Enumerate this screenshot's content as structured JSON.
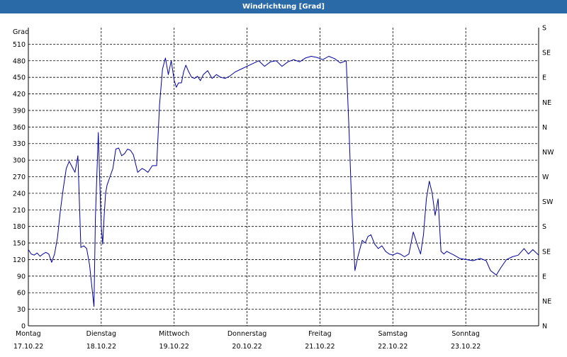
{
  "window": {
    "title": "Windrichtung [Grad]"
  },
  "chart_data": {
    "type": "line",
    "title": "Windrichtung [Grad]",
    "ylabel": "Grad",
    "ylim": [
      0,
      540
    ],
    "yticks": [
      0,
      30,
      60,
      90,
      120,
      150,
      180,
      210,
      240,
      270,
      300,
      330,
      360,
      390,
      420,
      450,
      480,
      510
    ],
    "right_axis": [
      "S",
      "SE",
      "E",
      "NE",
      "N",
      "NW",
      "W",
      "SW",
      "S",
      "SE",
      "E",
      "NE",
      "N"
    ],
    "xlim": [
      0,
      7
    ],
    "xticks": [
      {
        "day": "Montag",
        "date": "17.10.22"
      },
      {
        "day": "Dienstag",
        "date": "18.10.22"
      },
      {
        "day": "Mittwoch",
        "date": "19.10.22"
      },
      {
        "day": "Donnerstag",
        "date": "20.10.22"
      },
      {
        "day": "Freitag",
        "date": "21.10.22"
      },
      {
        "day": "Samstag",
        "date": "22.10.22"
      },
      {
        "day": "Sonntag",
        "date": "23.10.22"
      }
    ],
    "grid": true,
    "color": "#0000a0",
    "series": [
      {
        "name": "",
        "x": [
          0,
          0.04,
          0.08,
          0.12,
          0.16,
          0.2,
          0.24,
          0.28,
          0.32,
          0.36,
          0.4,
          0.44,
          0.48,
          0.52,
          0.56,
          0.6,
          0.64,
          0.68,
          0.72,
          0.76,
          0.8,
          0.84,
          0.88,
          0.9,
          0.92,
          0.96,
          0.98,
          1.0,
          1.02,
          1.04,
          1.06,
          1.08,
          1.12,
          1.16,
          1.2,
          1.24,
          1.28,
          1.32,
          1.36,
          1.4,
          1.44,
          1.5,
          1.56,
          1.6,
          1.64,
          1.7,
          1.76,
          1.8,
          1.84,
          1.88,
          1.92,
          1.96,
          2.0,
          2.03,
          2.06,
          2.1,
          2.13,
          2.16,
          2.2,
          2.24,
          2.28,
          2.32,
          2.36,
          2.4,
          2.46,
          2.52,
          2.58,
          2.64,
          2.7,
          2.76,
          2.84,
          2.92,
          3.0,
          3.08,
          3.16,
          3.24,
          3.32,
          3.4,
          3.48,
          3.56,
          3.64,
          3.72,
          3.8,
          3.88,
          3.96,
          4.04,
          4.12,
          4.2,
          4.28,
          4.36,
          4.4,
          4.44,
          4.48,
          4.52,
          4.55,
          4.58,
          4.62,
          4.66,
          4.7,
          4.75,
          4.8,
          4.85,
          4.9,
          4.95,
          5.0,
          5.06,
          5.1,
          5.16,
          5.22,
          5.28,
          5.34,
          5.38,
          5.42,
          5.46,
          5.5,
          5.54,
          5.58,
          5.62,
          5.66,
          5.7,
          5.74,
          5.78,
          5.84,
          5.92,
          6.0,
          6.1,
          6.2,
          6.28,
          6.34,
          6.38,
          6.42,
          6.48,
          6.56,
          6.64,
          6.72,
          6.8,
          6.86,
          6.92,
          7.0
        ],
        "y": [
          138,
          130,
          128,
          132,
          126,
          130,
          133,
          130,
          115,
          130,
          160,
          210,
          250,
          285,
          298,
          288,
          278,
          308,
          142,
          145,
          140,
          110,
          60,
          35,
          195,
          350,
          260,
          180,
          148,
          200,
          240,
          255,
          270,
          285,
          320,
          322,
          308,
          312,
          320,
          318,
          310,
          278,
          285,
          282,
          278,
          290,
          290,
          400,
          465,
          485,
          455,
          480,
          445,
          432,
          440,
          440,
          460,
          472,
          460,
          450,
          448,
          452,
          444,
          455,
          462,
          448,
          455,
          450,
          448,
          452,
          460,
          465,
          470,
          475,
          480,
          470,
          478,
          480,
          470,
          478,
          482,
          478,
          485,
          488,
          486,
          482,
          488,
          484,
          476,
          480,
          350,
          200,
          100,
          125,
          140,
          155,
          150,
          162,
          165,
          148,
          140,
          145,
          135,
          130,
          128,
          132,
          130,
          125,
          130,
          170,
          145,
          130,
          165,
          230,
          262,
          240,
          200,
          230,
          135,
          130,
          135,
          132,
          128,
          122,
          120,
          118,
          122,
          118,
          100,
          96,
          92,
          105,
          120,
          125,
          128,
          140,
          130,
          138,
          128
        ]
      }
    ]
  }
}
